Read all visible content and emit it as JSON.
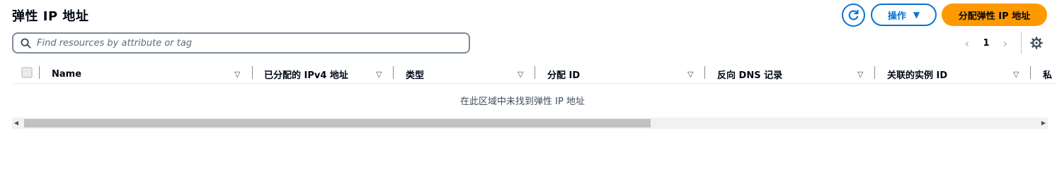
{
  "page": {
    "title": "弹性 IP 地址"
  },
  "toolbar": {
    "refresh_icon": "refresh-icon",
    "actions_label": "操作",
    "actions_caret": "▼",
    "allocate_label": "分配弹性 IP 地址"
  },
  "search": {
    "placeholder": "Find resources by attribute or tag",
    "value": ""
  },
  "pagination": {
    "prev": "‹",
    "current_page": "1",
    "next": "›"
  },
  "table": {
    "columns": [
      {
        "label": "Name"
      },
      {
        "label": "已分配的 IPv4 地址"
      },
      {
        "label": "类型"
      },
      {
        "label": "分配 ID"
      },
      {
        "label": "反向 DNS 记录"
      },
      {
        "label": "关联的实例 ID"
      },
      {
        "label": "私"
      }
    ],
    "sort_icon": "▽",
    "empty_message": "在此区域中未找到弹性 IP 地址"
  },
  "scrollbar": {
    "left_arrow": "◀",
    "right_arrow": "▶"
  },
  "colors": {
    "accent": "#0972d3",
    "primary_button": "#ff9900",
    "text": "#000716"
  }
}
